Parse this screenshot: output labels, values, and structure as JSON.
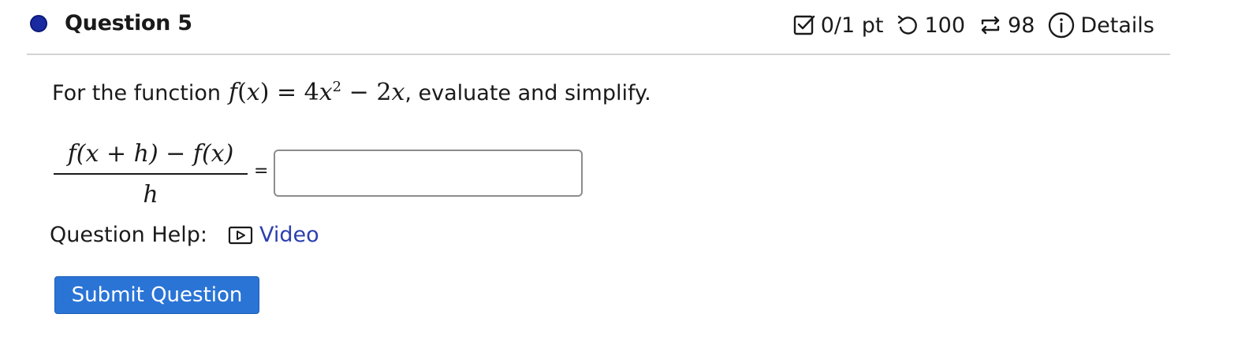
{
  "question": {
    "title": "Question 5",
    "status_color": "#1a2aa0"
  },
  "meta": {
    "points": "0/1 pt",
    "points_icon": "checkbox-icon",
    "attempts_left": "100",
    "attempts_icon": "undo-icon",
    "retries": "98",
    "retries_icon": "repeat-icon",
    "details_label": "Details",
    "details_icon": "info-icon"
  },
  "prompt": {
    "lead": "For the function",
    "function_name": "f",
    "function_arg": "x",
    "coef": "4",
    "var": "x",
    "exponent": "2",
    "minus": "−",
    "term2_coef": "2",
    "term2_var": "x",
    "tail": ", evaluate and simplify."
  },
  "expression": {
    "numerator": "f(x + h) − f(x)",
    "denominator": "h",
    "equals": "="
  },
  "answer": {
    "value": "",
    "placeholder": ""
  },
  "help": {
    "label": "Question Help:",
    "video_label": "Video",
    "video_icon": "play-icon",
    "link_color": "#2c3fb0"
  },
  "submit": {
    "label": "Submit Question",
    "color": "#2a74d6"
  }
}
